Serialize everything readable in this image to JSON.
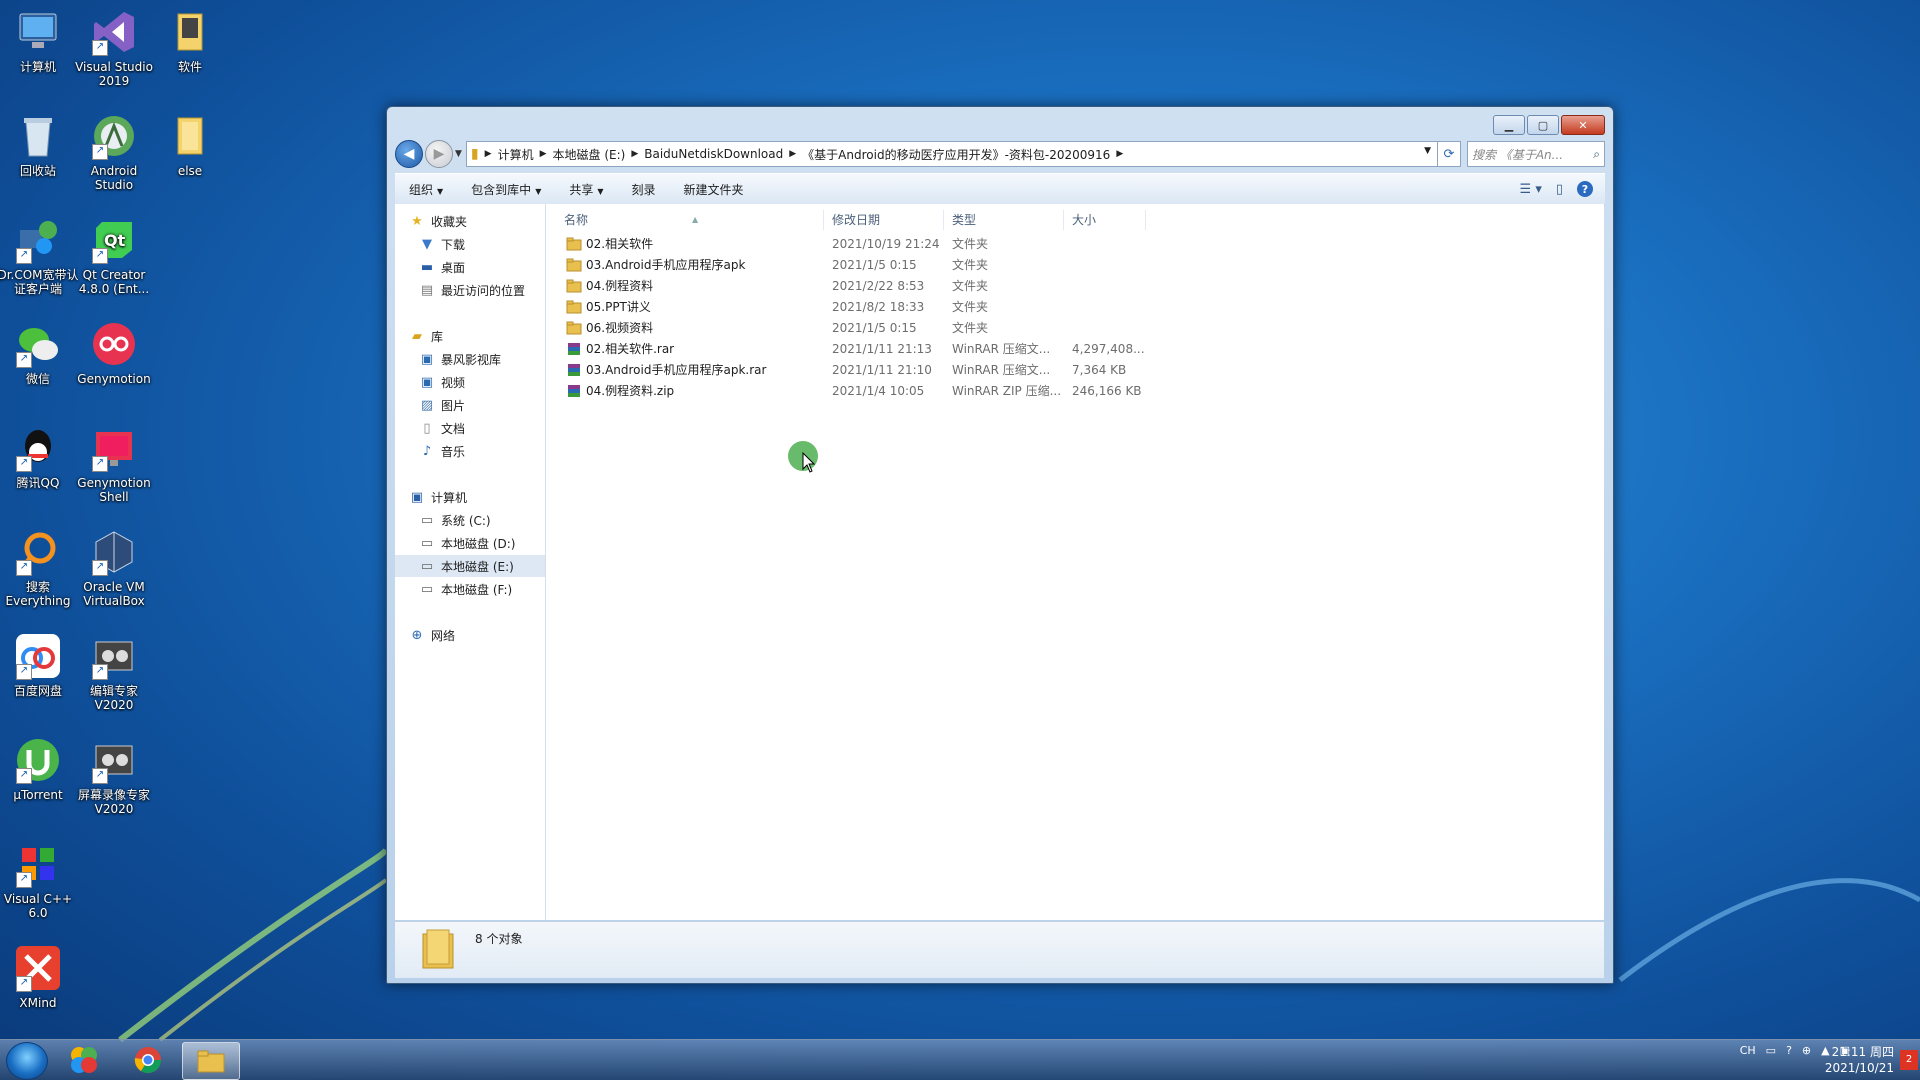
{
  "desktop": {
    "icons": [
      {
        "label": "计算机"
      },
      {
        "label": "Visual Studio 2019"
      },
      {
        "label": "软件"
      },
      {
        "label": "回收站"
      },
      {
        "label": "Android Studio"
      },
      {
        "label": "else"
      },
      {
        "label": "Dr.COM宽带认证客户端"
      },
      {
        "label": "Qt Creator 4.8.0 (Ent..."
      },
      {
        "label": "微信"
      },
      {
        "label": "Genymotion"
      },
      {
        "label": "腾讯QQ"
      },
      {
        "label": "Genymotion Shell"
      },
      {
        "label": "搜索 Everything"
      },
      {
        "label": "Oracle VM VirtualBox"
      },
      {
        "label": "百度网盘"
      },
      {
        "label": "编辑专家V2020"
      },
      {
        "label": "µTorrent"
      },
      {
        "label": "屏幕录像专家V2020"
      },
      {
        "label": "Visual C++ 6.0"
      },
      {
        "label": "XMind"
      }
    ]
  },
  "window": {
    "address": {
      "crumbs": [
        "计算机",
        "本地磁盘 (E:)",
        "BaiduNetdiskDownload",
        "《基于Android的移动医疗应用开发》-资料包-20200916"
      ],
      "search_placeholder": "搜索 《基于An..."
    },
    "toolbar": {
      "organize": "组织",
      "include": "包含到库中",
      "share": "共享",
      "burn": "刻录",
      "new_folder": "新建文件夹"
    },
    "nav": {
      "favorites": "收藏夹",
      "downloads": "下载",
      "desktop": "桌面",
      "recent": "最近访问的位置",
      "libraries": "库",
      "storm": "暴风影视库",
      "videos": "视频",
      "pictures": "图片",
      "documents": "文档",
      "music": "音乐",
      "computer": "计算机",
      "drive_c": "系统 (C:)",
      "drive_d": "本地磁盘 (D:)",
      "drive_e": "本地磁盘 (E:)",
      "drive_f": "本地磁盘 (F:)",
      "network": "网络"
    },
    "columns": {
      "name": "名称",
      "date": "修改日期",
      "type": "类型",
      "size": "大小"
    },
    "files": [
      {
        "name": "02.相关软件",
        "date": "2021/10/19 21:24",
        "type": "文件夹",
        "size": "",
        "kind": "folder"
      },
      {
        "name": "03.Android手机应用程序apk",
        "date": "2021/1/5 0:15",
        "type": "文件夹",
        "size": "",
        "kind": "folder"
      },
      {
        "name": "04.例程资料",
        "date": "2021/2/22 8:53",
        "type": "文件夹",
        "size": "",
        "kind": "folder"
      },
      {
        "name": "05.PPT讲义",
        "date": "2021/8/2 18:33",
        "type": "文件夹",
        "size": "",
        "kind": "folder"
      },
      {
        "name": "06.视频资料",
        "date": "2021/1/5 0:15",
        "type": "文件夹",
        "size": "",
        "kind": "folder"
      },
      {
        "name": "02.相关软件.rar",
        "date": "2021/1/11 21:13",
        "type": "WinRAR 压缩文...",
        "size": "4,297,408...",
        "kind": "rar"
      },
      {
        "name": "03.Android手机应用程序apk.rar",
        "date": "2021/1/11 21:10",
        "type": "WinRAR 压缩文...",
        "size": "7,364 KB",
        "kind": "rar"
      },
      {
        "name": "04.例程资料.zip",
        "date": "2021/1/4 10:05",
        "type": "WinRAR ZIP 压缩...",
        "size": "246,166 KB",
        "kind": "rar"
      }
    ],
    "details": {
      "count": "8 个对象"
    }
  },
  "taskbar": {
    "tray_lang": "CH",
    "clock_time": "21:11 周四",
    "clock_date": "2021/10/21",
    "notif_count": "2"
  }
}
